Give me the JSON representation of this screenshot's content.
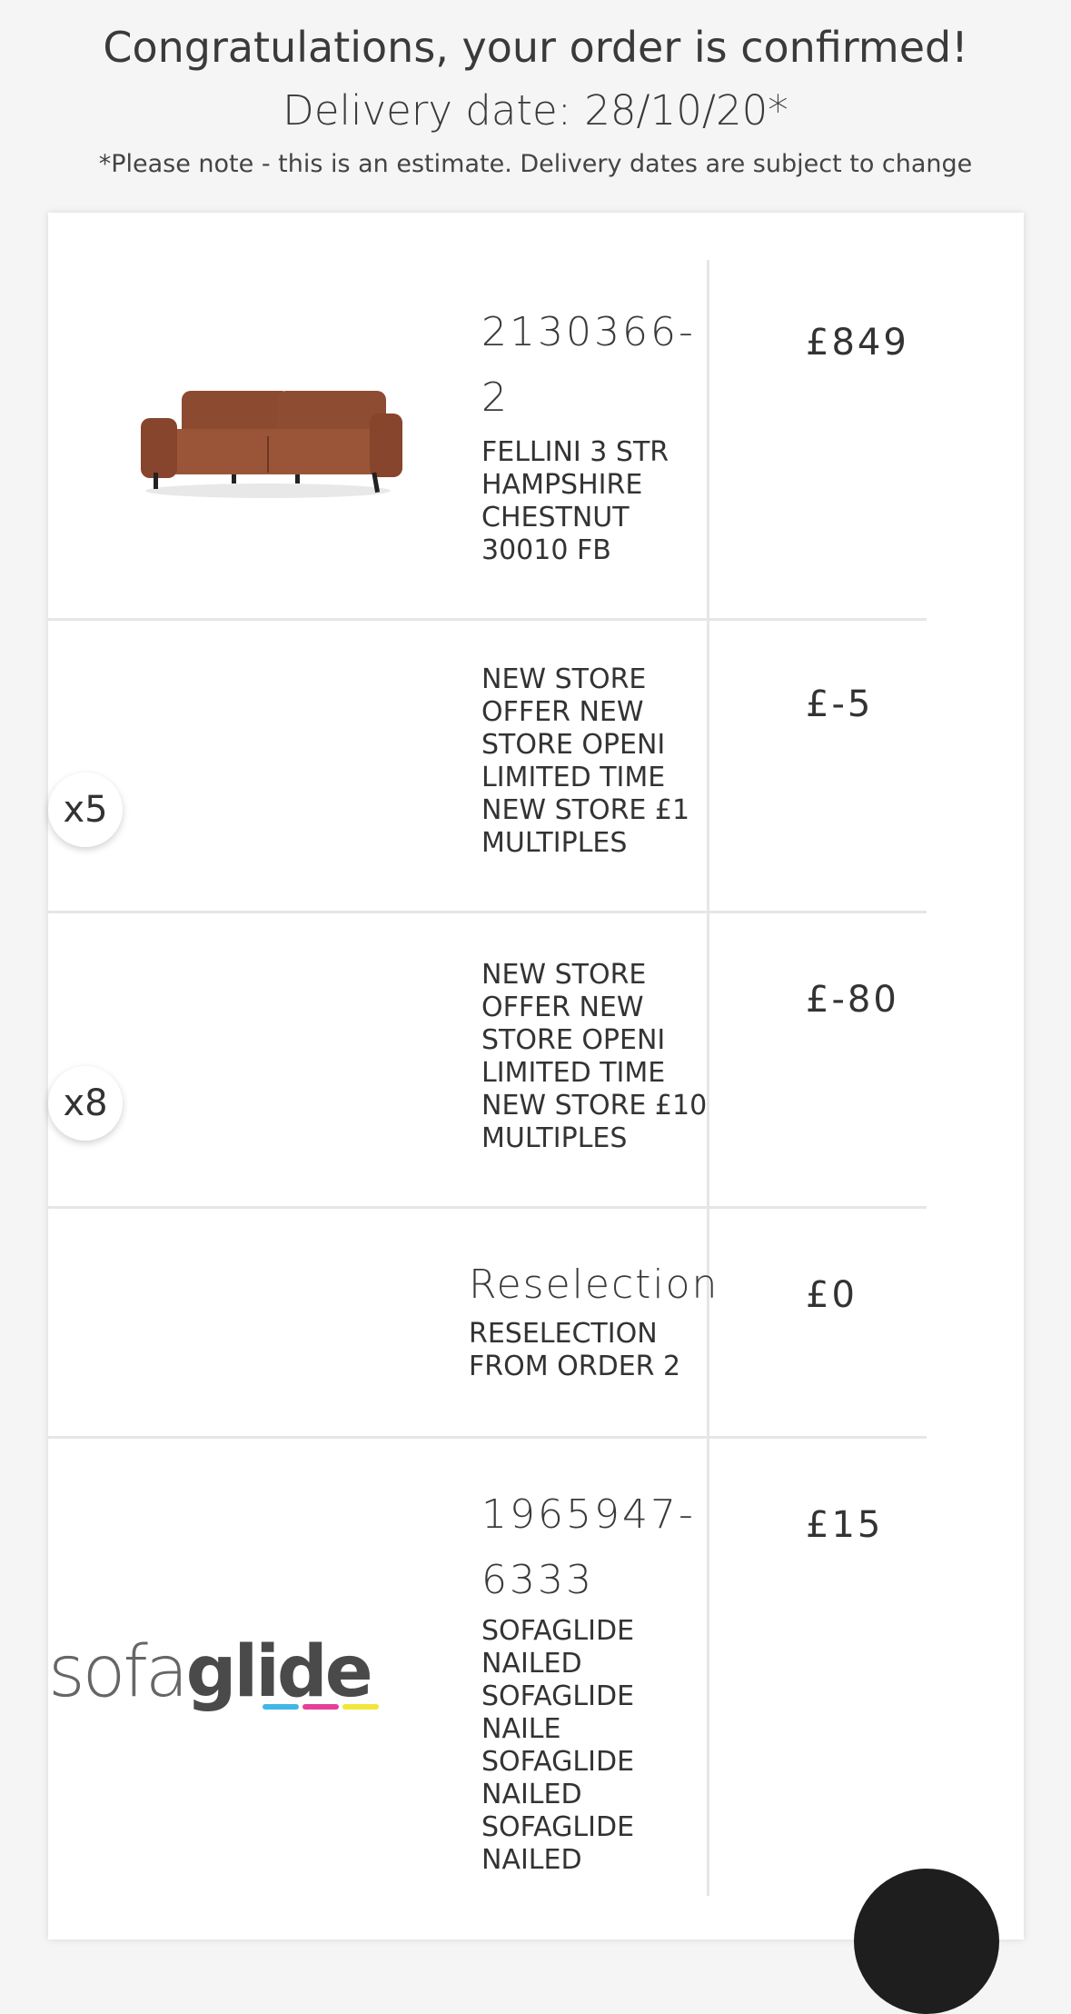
{
  "header": {
    "title": "Congratulations, your order is confirmed!",
    "delivery": "Delivery date: 28/10/20*",
    "note": "*Please note - this is an estimate. Delivery dates are subject to change"
  },
  "items": [
    {
      "code": "2130366-2",
      "description": "FELLINI 3 STR HAMPSHIRE CHESTNUT 30010 FB",
      "price": "£849",
      "image": "sofa-image"
    },
    {
      "quantity": "x5",
      "description": "NEW STORE OFFER NEW STORE OPENI LIMITED TIME NEW STORE £1 MULTIPLES",
      "price": "£-5"
    },
    {
      "quantity": "x8",
      "description": "NEW STORE OFFER NEW STORE OPENI LIMITED TIME NEW STORE £10 MULTIPLES",
      "price": "£-80"
    },
    {
      "title": "Reselection",
      "description": "RESELECTION FROM ORDER 2",
      "price": "£0"
    },
    {
      "code": "1965947-6333",
      "description": "SOFAGLIDE NAILED SOFAGLIDE NAILE SOFAGLIDE NAILED SOFAGLIDE NAILED",
      "price": "£15",
      "logo": {
        "text_light": "sofa",
        "text_bold": "glide",
        "bar_colors": [
          "#3fb8e6",
          "#e63f9a",
          "#f2e63a"
        ]
      }
    }
  ],
  "colors": {
    "background": "#f5f5f5",
    "card": "#ffffff",
    "divider": "#e6e6e6"
  }
}
